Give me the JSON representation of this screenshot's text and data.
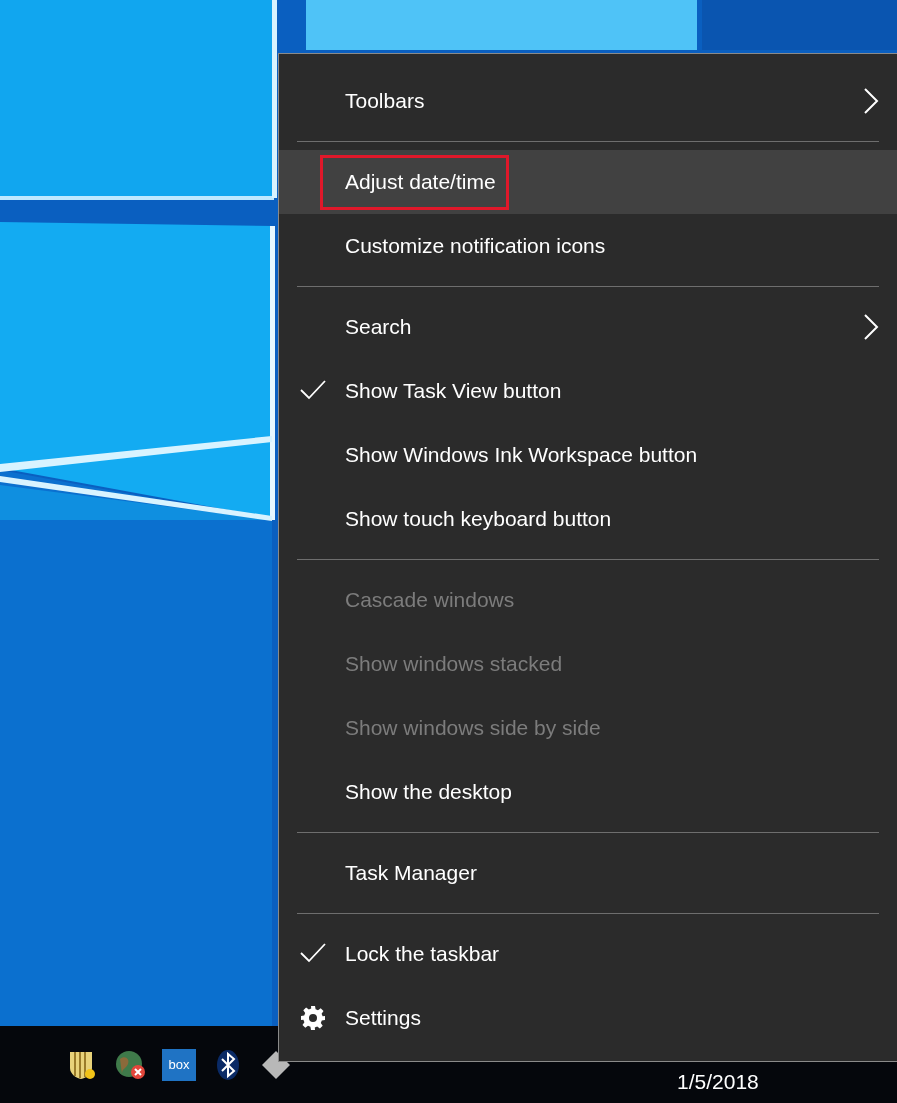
{
  "context_menu": {
    "items": [
      {
        "kind": "item",
        "label": "Toolbars",
        "submenu": true,
        "checked": false,
        "disabled": false,
        "selected": false,
        "annotated": false
      },
      {
        "kind": "separator"
      },
      {
        "kind": "item",
        "label": "Adjust date/time",
        "submenu": false,
        "checked": false,
        "disabled": false,
        "selected": true,
        "annotated": true
      },
      {
        "kind": "item",
        "label": "Customize notification icons",
        "submenu": false,
        "checked": false,
        "disabled": false,
        "selected": false,
        "annotated": false
      },
      {
        "kind": "separator"
      },
      {
        "kind": "item",
        "label": "Search",
        "submenu": true,
        "checked": false,
        "disabled": false,
        "selected": false,
        "annotated": false
      },
      {
        "kind": "item",
        "label": "Show Task View button",
        "submenu": false,
        "checked": true,
        "disabled": false,
        "selected": false,
        "annotated": false
      },
      {
        "kind": "item",
        "label": "Show Windows Ink Workspace button",
        "submenu": false,
        "checked": false,
        "disabled": false,
        "selected": false,
        "annotated": false
      },
      {
        "kind": "item",
        "label": "Show touch keyboard button",
        "submenu": false,
        "checked": false,
        "disabled": false,
        "selected": false,
        "annotated": false
      },
      {
        "kind": "separator"
      },
      {
        "kind": "item",
        "label": "Cascade windows",
        "submenu": false,
        "checked": false,
        "disabled": true,
        "selected": false,
        "annotated": false
      },
      {
        "kind": "item",
        "label": "Show windows stacked",
        "submenu": false,
        "checked": false,
        "disabled": true,
        "selected": false,
        "annotated": false
      },
      {
        "kind": "item",
        "label": "Show windows side by side",
        "submenu": false,
        "checked": false,
        "disabled": true,
        "selected": false,
        "annotated": false
      },
      {
        "kind": "item",
        "label": "Show the desktop",
        "submenu": false,
        "checked": false,
        "disabled": false,
        "selected": false,
        "annotated": false
      },
      {
        "kind": "separator"
      },
      {
        "kind": "item",
        "label": "Task Manager",
        "submenu": false,
        "checked": false,
        "disabled": false,
        "selected": false,
        "annotated": false
      },
      {
        "kind": "separator"
      },
      {
        "kind": "item",
        "label": "Lock the taskbar",
        "submenu": false,
        "checked": true,
        "disabled": false,
        "selected": false,
        "annotated": false
      },
      {
        "kind": "gear_item",
        "label": "Settings",
        "submenu": false,
        "checked": false,
        "disabled": false,
        "selected": false,
        "annotated": false
      }
    ]
  },
  "taskbar": {
    "tray_icons": [
      {
        "kind": "shield"
      },
      {
        "kind": "globe_error"
      },
      {
        "kind": "box_app",
        "label": "box"
      },
      {
        "kind": "bluetooth"
      },
      {
        "kind": "diamond"
      }
    ],
    "date": "1/5/2018"
  }
}
